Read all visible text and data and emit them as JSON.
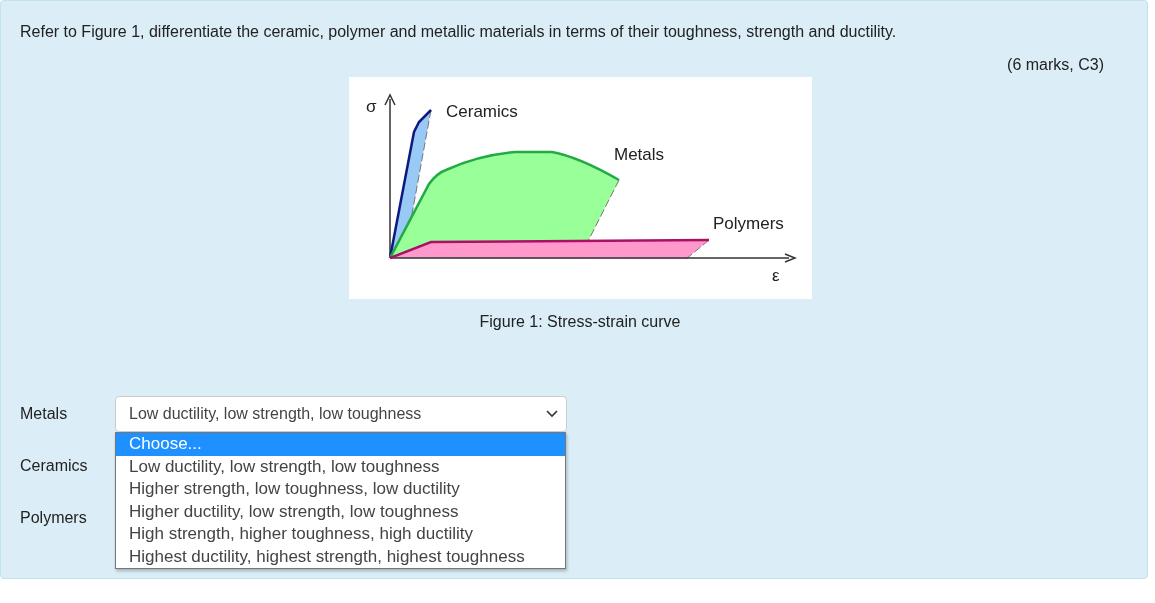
{
  "question": {
    "text": "Refer to Figure 1, differentiate the ceramic, polymer and metallic materials in terms of their toughness, strength and ductility.",
    "marks": "(6 marks, C3)"
  },
  "figure": {
    "axis_y_label": "σ",
    "axis_x_label": "ε",
    "caption": "Figure 1: Stress-strain curve",
    "curves": [
      {
        "kind": "ceramic",
        "label": "Ceramics"
      },
      {
        "kind": "metal",
        "label": "Metals"
      },
      {
        "kind": "polymer",
        "label": "Polymers"
      }
    ]
  },
  "answers": [
    {
      "label": "Metals",
      "value": "Low ductility, low strength, low toughness",
      "expanded": true,
      "options": [
        {
          "text": "Choose...",
          "highlighted": true
        },
        {
          "text": "Low ductility, low strength, low toughness",
          "highlighted": false
        },
        {
          "text": "Higher strength, low toughness, low ductility",
          "highlighted": false
        },
        {
          "text": "Higher ductility, low strength, low toughness",
          "highlighted": false
        },
        {
          "text": "High strength, higher toughness, high ductility",
          "highlighted": false
        },
        {
          "text": "Highest ductility, highest strength, highest toughness",
          "highlighted": false
        }
      ]
    },
    {
      "label": "Ceramics"
    },
    {
      "label": "Polymers"
    }
  ]
}
